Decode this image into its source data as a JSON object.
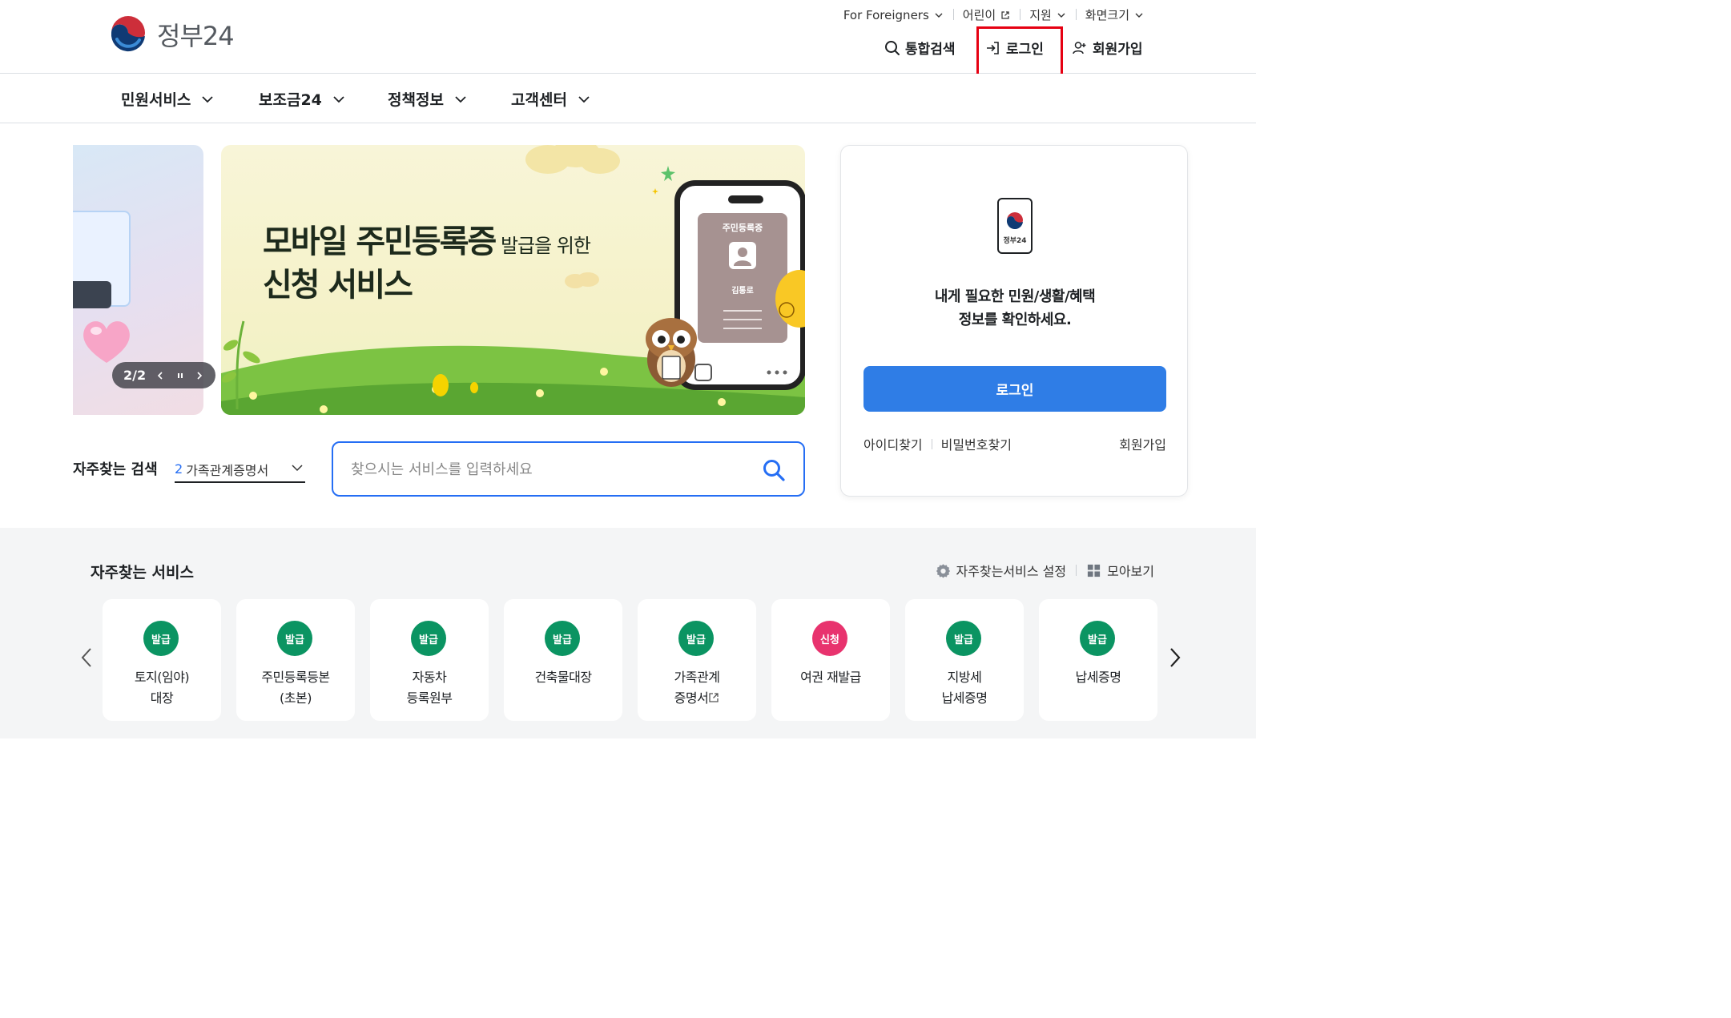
{
  "header": {
    "logo_text": "정부24",
    "utility": [
      "For Foreigners",
      "어린이",
      "지원",
      "화면크기"
    ],
    "search_label": "통합검색",
    "login_label": "로그인",
    "signup_label": "회원가입"
  },
  "gnb": [
    "민원서비스",
    "보조금24",
    "정책정보",
    "고객센터"
  ],
  "banner": {
    "pager_text": "2/2",
    "title_bold": "모바일 주민등록증",
    "title_small": " 발급을 위한",
    "title_line2": "신청 서비스",
    "card_label": "주민등록증",
    "card_name": "김통로"
  },
  "search": {
    "freq_label": "자주찾는 검색",
    "freq_num": "2",
    "freq_value": "가족관계증명서",
    "placeholder": "찾으시는 서비스를 입력하세요"
  },
  "login_card": {
    "app_text": "정부24",
    "message_line1": "내게 필요한 민원/생활/혜택",
    "message_line2": "정보를 확인하세요.",
    "login_button": "로그인",
    "find_id": "아이디찾기",
    "find_pw": "비밀번호찾기",
    "signup": "회원가입"
  },
  "services": {
    "title": "자주찾는 서비스",
    "settings_label": "자주찾는서비스 설정",
    "collect_label": "모아보기",
    "items": [
      {
        "badge": "발급",
        "line1": "토지(임야)",
        "line2": "대장",
        "color": "#0b9462"
      },
      {
        "badge": "발급",
        "line1": "주민등록등본",
        "line2": "(초본)",
        "color": "#0b9462"
      },
      {
        "badge": "발급",
        "line1": "자동차",
        "line2": "등록원부",
        "color": "#0b9462"
      },
      {
        "badge": "발급",
        "line1": "건축물대장",
        "line2": "",
        "color": "#0b9462"
      },
      {
        "badge": "발급",
        "line1": "가족관계",
        "line2": "증명서",
        "color": "#0b9462"
      },
      {
        "badge": "신청",
        "line1": "여권 재발급",
        "line2": "",
        "color": "#e8336e"
      },
      {
        "badge": "발급",
        "line1": "지방세",
        "line2": "납세증명",
        "color": "#0b9462"
      },
      {
        "badge": "발급",
        "line1": "납세증명",
        "line2": "",
        "color": "#0b9462"
      }
    ]
  },
  "colors": {
    "primary": "#2f7de6",
    "search_border": "#256ef4",
    "badge_green": "#0b9462",
    "badge_red": "#e8336e",
    "highlight": "#e60012"
  }
}
